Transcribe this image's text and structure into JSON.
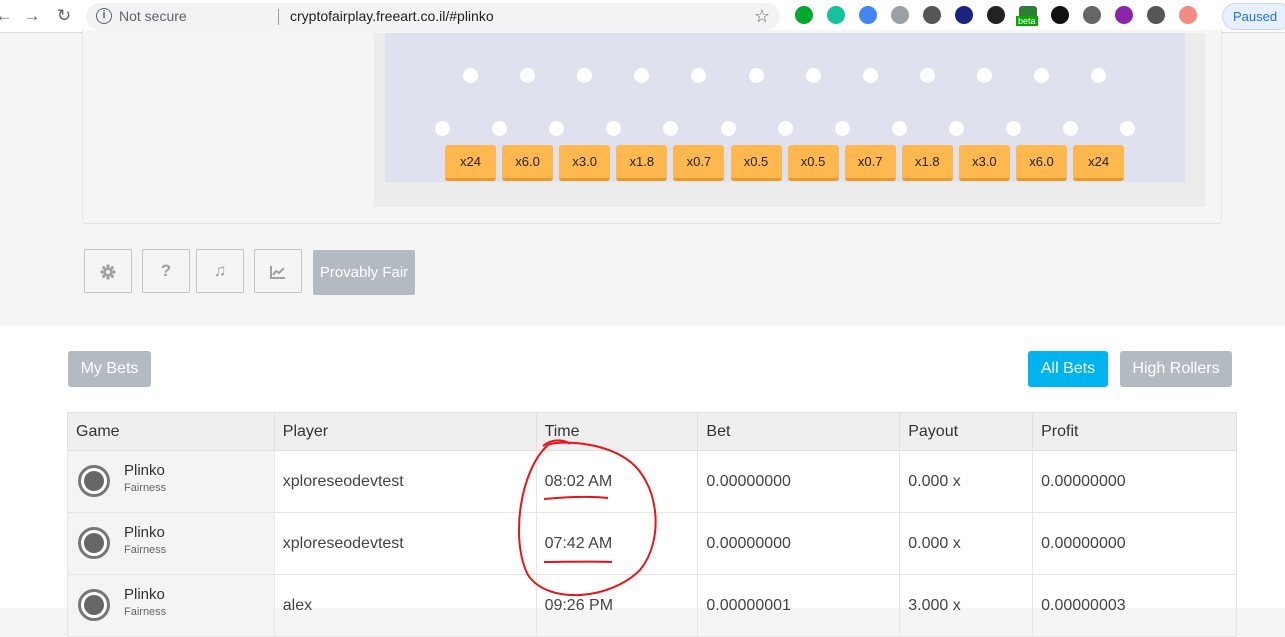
{
  "browser": {
    "security_label": "Not secure",
    "url": "cryptofairplay.freeart.co.il/#plinko",
    "profile_status": "Paused",
    "extensions": [
      "evernote-icon",
      "grammarly-icon",
      "translate-icon",
      "camera-icon",
      "recycle-icon",
      "save-icon",
      "color-picker-icon",
      "beta-icon",
      "x-icon",
      "note-icon",
      "pen-icon",
      "move-icon",
      "arrow-icon"
    ],
    "beta_label": "beta"
  },
  "plinko": {
    "multipliers": [
      "x24",
      "x6.0",
      "x3.0",
      "x1.8",
      "x0.7",
      "x0.5",
      "x0.5",
      "x0.7",
      "x1.8",
      "x3.0",
      "x6.0",
      "x24"
    ]
  },
  "tools": {
    "settings_icon": "gear-icon",
    "help_label": "?",
    "sound_icon": "music-icon",
    "stats_icon": "chart-icon",
    "provably_fair_label": "Provably Fair"
  },
  "bets": {
    "my_bets_label": "My Bets",
    "all_bets_label": "All Bets",
    "high_rollers_label": "High Rollers",
    "columns": [
      "Game",
      "Player",
      "Time",
      "Bet",
      "Payout",
      "Profit"
    ],
    "rows": [
      {
        "game": "Plinko",
        "sub": "Fairness",
        "player": "xploreseodevtest",
        "time": "08:02 AM",
        "bet": "0.00000000",
        "payout": "0.000 x",
        "profit": "0.00000000"
      },
      {
        "game": "Plinko",
        "sub": "Fairness",
        "player": "xploreseodevtest",
        "time": "07:42 AM",
        "bet": "0.00000000",
        "payout": "0.000 x",
        "profit": "0.00000000"
      },
      {
        "game": "Plinko",
        "sub": "Fairness",
        "player": "alex",
        "time": "09:26 PM",
        "bet": "0.00000001",
        "payout": "3.000 x",
        "profit": "0.00000003"
      }
    ]
  },
  "colors": {
    "accent_blue": "#00b4f0",
    "multiplier": "#ffb84d",
    "annotation": "#e8141a"
  }
}
